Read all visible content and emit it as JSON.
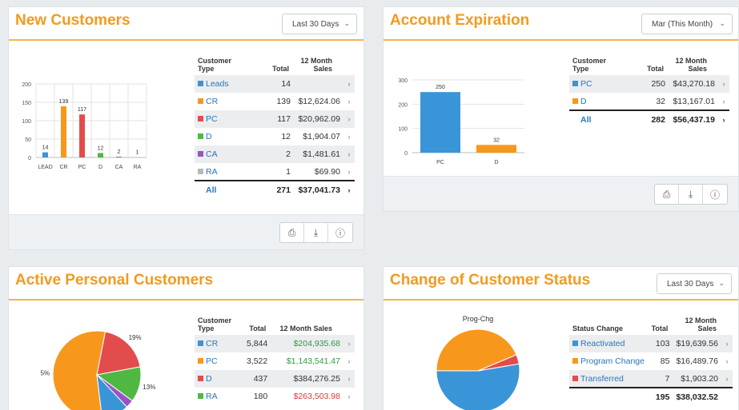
{
  "colors": {
    "accent": "#f39a1e",
    "blue": "#3a95d8",
    "orange": "#f7981d",
    "red": "#e34c4c",
    "green": "#4fb843",
    "purple": "#9a52c7",
    "gray": "#b9b9b9"
  },
  "new_customers": {
    "title": "New Customers",
    "range": "Last 30 Days",
    "table_headers": {
      "type": "Customer Type",
      "total": "Total",
      "sales": "12 Month Sales"
    },
    "rows": [
      {
        "name": "Leads",
        "total": "14",
        "sales": ""
      },
      {
        "name": "CR",
        "total": "139",
        "sales": "$12,624.06"
      },
      {
        "name": "PC",
        "total": "117",
        "sales": "$20,962.09"
      },
      {
        "name": "D",
        "total": "12",
        "sales": "$1,904.07"
      },
      {
        "name": "CA",
        "total": "2",
        "sales": "$1,481.61"
      },
      {
        "name": "RA",
        "total": "1",
        "sales": "$69.90"
      }
    ],
    "total_row": {
      "name": "All",
      "total": "271",
      "sales": "$37,041.73"
    },
    "chart_data": {
      "type": "bar",
      "categories": [
        "LEAD",
        "CR",
        "PC",
        "D",
        "CA",
        "RA"
      ],
      "values": [
        14,
        139,
        117,
        12,
        2,
        1
      ],
      "data_labels": [
        "14",
        "139",
        "117",
        "12",
        "2",
        "1"
      ],
      "colors": [
        "#3a95d8",
        "#f7981d",
        "#e34c4c",
        "#4fb843",
        "#9a52c7",
        "#b9b9b9"
      ],
      "ylim": [
        0,
        200
      ],
      "yticks": [
        0,
        50,
        100,
        150,
        200
      ],
      "ytick_labels": [
        "0",
        "50",
        "100",
        "150",
        "200"
      ],
      "grid": true
    }
  },
  "account_expiration": {
    "title": "Account Expiration",
    "range": "Mar (This Month)",
    "table_headers": {
      "type": "Customer Type",
      "total": "Total",
      "sales": "12 Month Sales"
    },
    "rows": [
      {
        "name": "PC",
        "total": "250",
        "sales": "$43,270.18"
      },
      {
        "name": "D",
        "total": "32",
        "sales": "$13,167.01"
      }
    ],
    "total_row": {
      "name": "All",
      "total": "282",
      "sales": "$56,437.19"
    },
    "chart_data": {
      "type": "bar",
      "categories": [
        "PC",
        "D"
      ],
      "values": [
        250,
        32
      ],
      "data_labels": [
        "250",
        "32"
      ],
      "colors": [
        "#3a95d8",
        "#f7981d"
      ],
      "ylim": [
        0,
        300
      ],
      "yticks": [
        0,
        100,
        200,
        300
      ],
      "ytick_labels": [
        "0",
        "100",
        "200",
        "300"
      ],
      "grid": false
    }
  },
  "active_personal": {
    "title": "Active Personal Customers",
    "table_headers": {
      "type": "Customer Type",
      "total": "Total",
      "sales": "12 Month Sales"
    },
    "rows": [
      {
        "name": "CR",
        "total": "5,844",
        "sales": "$204,935.68",
        "tone": "green"
      },
      {
        "name": "PC",
        "total": "3,522",
        "sales": "$1,143,541.47",
        "tone": "green"
      },
      {
        "name": "D",
        "total": "437",
        "sales": "$384,276.25",
        "tone": ""
      },
      {
        "name": "RA",
        "total": "180",
        "sales": "$263,503.98",
        "tone": "red"
      }
    ],
    "chart_data": {
      "type": "pie",
      "slices": [
        {
          "value": 55,
          "color": "#f7981d",
          "label": "55%"
        },
        {
          "value": 19,
          "color": "#e34c4c",
          "label": "19%"
        },
        {
          "value": 13,
          "color": "#4fb843",
          "label": "13%"
        },
        {
          "value": 3,
          "color": "#9a52c7",
          "label": ""
        },
        {
          "value": 10,
          "color": "#3a95d8",
          "label": "10%"
        }
      ]
    }
  },
  "customer_status": {
    "title": "Change of Customer Status",
    "range": "Last 30 Days",
    "table_headers": {
      "type": "Status Change",
      "total": "Total",
      "sales": "12 Month Sales"
    },
    "rows": [
      {
        "name": "Reactivated",
        "total": "103",
        "sales": "$19,639.56"
      },
      {
        "name": "Program Change",
        "total": "85",
        "sales": "$16,489.76"
      },
      {
        "name": "Transferred",
        "total": "7",
        "sales": "$1,903.20"
      }
    ],
    "total_row": {
      "name": "",
      "total": "195",
      "sales": "$38,032.52"
    },
    "chart_data": {
      "type": "pie",
      "title": "Prog-Chg",
      "slices": [
        {
          "value": 52.8,
          "color": "#3a95d8"
        },
        {
          "value": 43.6,
          "color": "#f7981d"
        },
        {
          "value": 3.6,
          "color": "#e34c4c"
        }
      ]
    }
  }
}
